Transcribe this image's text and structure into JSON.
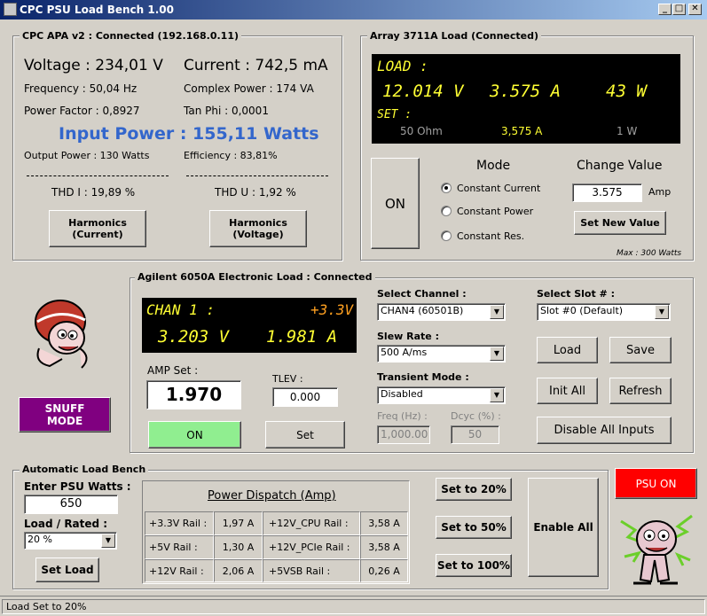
{
  "window": {
    "title": "CPC PSU Load Bench 1.00",
    "minimize": "_",
    "maximize": "□",
    "close": "✕"
  },
  "cpc": {
    "group_label": "CPC APA v2 : Connected (192.168.0.11)",
    "voltage": "Voltage : 234,01 V",
    "current": "Current : 742,5 mA",
    "frequency": "Frequency : 50,04 Hz",
    "complex_power": "Complex Power : 174 VA",
    "power_factor": "Power Factor : 0,8927",
    "tan_phi": "Tan Phi  : 0,0001",
    "input_power": "Input Power : 155,11 Watts",
    "output_power": "Output Power : 130 Watts",
    "efficiency": "Efficiency : 83,81%",
    "thd_i": "THD I : 19,89 %",
    "thd_u": "THD U : 1,92 %",
    "harm_current_l1": "Harmonics",
    "harm_current_l2": "(Current)",
    "harm_voltage_l1": "Harmonics",
    "harm_voltage_l2": "(Voltage)"
  },
  "array": {
    "group_label": "Array 3711A Load (Connected)",
    "lcd_title": "LOAD :",
    "voltage": "12.014 V",
    "current": "3.575 A",
    "power": "43 W",
    "set_label": "SET :",
    "set_mode": "50 Ohm",
    "set_current": "3,575 A",
    "set_power": "1 W",
    "on_button": "ON",
    "mode_title": "Mode",
    "modes": [
      "Constant Current",
      "Constant Power",
      "Constant Res."
    ],
    "change_title": "Change Value",
    "value": "3.575",
    "unit": "Amp",
    "set_new_value": "Set New Value",
    "max_note": "Max : 300 Watts"
  },
  "agilent": {
    "group_label": "Agilent 6050A Electronic Load : Connected",
    "lcd_channel": "CHAN 1 :",
    "lcd_rail": "+3.3V",
    "lcd_voltage": "3.203 V",
    "lcd_current": "1.981 A",
    "amp_set_label": "AMP Set :",
    "amp_set_value": "1.970",
    "tlev_label": "TLEV :",
    "tlev_value": "0.000",
    "on_button": "ON",
    "set_button": "Set",
    "select_channel_label": "Select Channel :",
    "select_channel_value": "CHAN4 (60501B)",
    "slew_rate_label": "Slew Rate :",
    "slew_rate_value": "500 A/ms",
    "transient_label": "Transient Mode :",
    "transient_value": "Disabled",
    "freq_label": "Freq (Hz) :",
    "freq_value": "1,000.00",
    "dcyc_label": "Dcyc (%) :",
    "dcyc_value": "50",
    "select_slot_label": "Select Slot # :",
    "select_slot_value": "Slot #0 (Default)",
    "load_button": "Load",
    "save_button": "Save",
    "init_all_button": "Init All",
    "refresh_button": "Refresh",
    "disable_all_button": "Disable All Inputs"
  },
  "snuff": {
    "line1": "SNUFF",
    "line2": "MODE"
  },
  "bench": {
    "group_label": "Automatic Load Bench",
    "psu_watts_label": "Enter PSU Watts :",
    "psu_watts_value": "650",
    "load_rated_label": "Load / Rated :",
    "load_rated_value": "20 %",
    "set_load_button": "Set Load",
    "dispatch_title": "Power Dispatch (Amp)",
    "rails": [
      {
        "name": "+3.3V Rail :",
        "value": "1,97 A",
        "name2": "+12V_CPU Rail :",
        "value2": "3,58 A"
      },
      {
        "name": "+5V Rail :",
        "value": "1,30 A",
        "name2": "+12V_PCIe Rail :",
        "value2": "3,58 A"
      },
      {
        "name": "+12V Rail :",
        "value": "2,06 A",
        "name2": "+5VSB Rail :",
        "value2": "0,26 A"
      }
    ],
    "set20": "Set to 20%",
    "set50": "Set to 50%",
    "set100": "Set to 100%",
    "enable_all": "Enable All"
  },
  "psu_on_button": "PSU ON",
  "status": {
    "text": "Load Set to 20%"
  },
  "colors": {
    "lcd_yellow": "#ffff33",
    "lcd_orange": "#ffa020",
    "input_power_blue": "#3366cc",
    "snuff_purple": "#800080",
    "psu_red": "#ff0000",
    "on_green": "#90ee90"
  }
}
